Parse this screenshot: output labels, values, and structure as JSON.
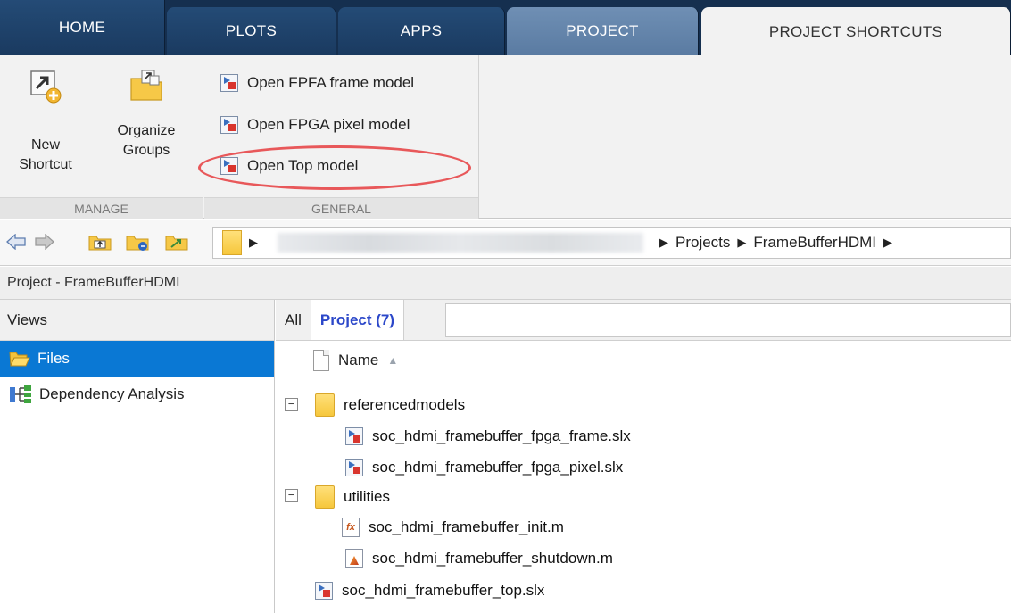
{
  "tabs": [
    {
      "label": "HOME"
    },
    {
      "label": "PLOTS"
    },
    {
      "label": "APPS"
    },
    {
      "label": "PROJECT"
    },
    {
      "label": "PROJECT SHORTCUTS"
    }
  ],
  "ribbon": {
    "manage": {
      "caption": "MANAGE",
      "new_shortcut_line1": "New",
      "new_shortcut_line2": "Shortcut",
      "organize_line1": "Organize",
      "organize_line2": "Groups"
    },
    "general": {
      "caption": "GENERAL",
      "shortcuts": [
        {
          "label": "Open FPFA frame model"
        },
        {
          "label": "Open FPGA pixel model"
        },
        {
          "label": "Open Top model"
        }
      ]
    }
  },
  "address": {
    "crumbs": [
      "Projects",
      "FrameBufferHDMI"
    ]
  },
  "project_title": "Project - FrameBufferHDMI",
  "views": {
    "header": "Views",
    "items": [
      {
        "label": "Files"
      },
      {
        "label": "Dependency Analysis"
      }
    ]
  },
  "files": {
    "tab_all": "All",
    "tab_project": "Project (7)",
    "column_name": "Name",
    "rows": [
      {
        "label": "referencedmodels"
      },
      {
        "label": "soc_hdmi_framebuffer_fpga_frame.slx"
      },
      {
        "label": "soc_hdmi_framebuffer_fpga_pixel.slx"
      },
      {
        "label": "utilities"
      },
      {
        "label": "soc_hdmi_framebuffer_init.m"
      },
      {
        "label": "soc_hdmi_framebuffer_shutdown.m"
      },
      {
        "label": "soc_hdmi_framebuffer_top.slx"
      }
    ]
  },
  "colors": {
    "tabbar": "#152f4f",
    "selection": "#0a78d4",
    "highlight": "#e8585a",
    "project_tab_text": "#2b47c9"
  }
}
